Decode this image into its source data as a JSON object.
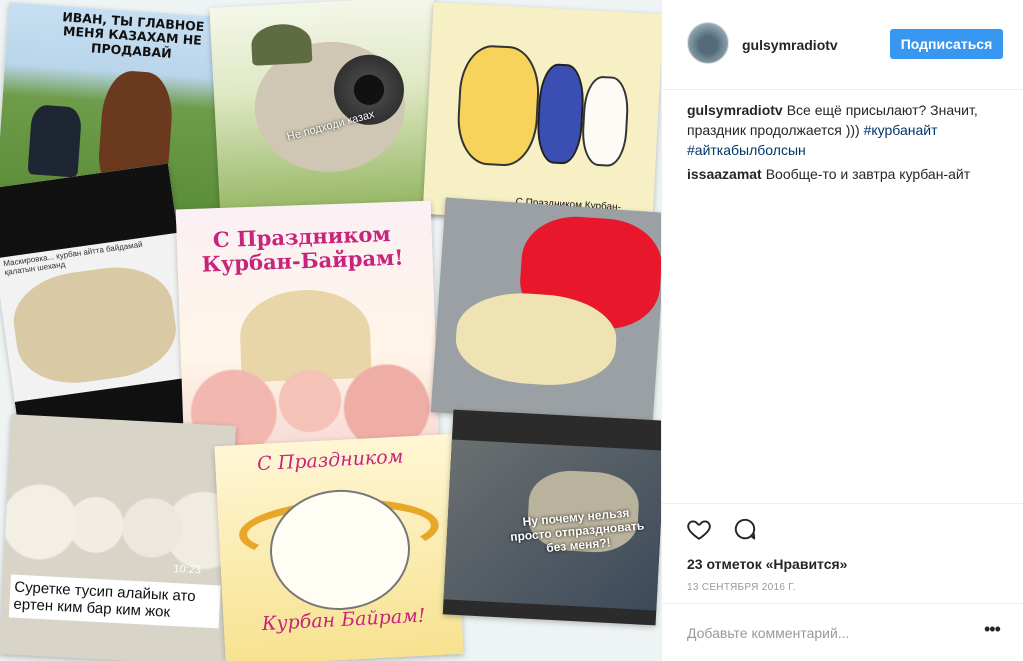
{
  "photo": {
    "card1_caption": "ИВАН, ТЫ ГЛАВНОЕ МЕНЯ КАЗАХАМ НЕ ПРОДАВАЙ",
    "card2_caption": "Не подходи казах",
    "card3_caption": "С Праздником Курбан-Байрам :)",
    "card4_caption": "Маскировка... курбан айтта байдамай қалатын шеханд",
    "card5_caption": "С Праздником Курбан-Байрам!",
    "card7_caption": "Суретке тусип алайык ато ертен ким бар ким жок",
    "card7_time": "10:23",
    "card8_caption_top": "С Праздником",
    "card8_caption_bottom": "Курбан Байрам!",
    "card9_caption": "Ну почему нельзя просто отпраздновать без меня?!"
  },
  "post": {
    "username": "gulsymradiotv",
    "follow_label": "Подписаться"
  },
  "comments": [
    {
      "user": "gulsymradiotv",
      "text": "Все ещё присылают? Значит, праздник продолжается ))) ",
      "tags": [
        "#курбанайт",
        "#айткабылболсын"
      ]
    },
    {
      "user": "issaazamat",
      "text": "Вообще-то и завтра курбан-айт",
      "tags": []
    }
  ],
  "footer": {
    "likes": "23 отметок «Нравится»",
    "date": "13 СЕНТЯБРЯ 2016 Г.",
    "comment_placeholder": "Добавьте комментарий...",
    "more_label": "•••"
  },
  "colors": {
    "accent": "#3897f0",
    "hashtag": "#003569",
    "text": "#262626",
    "muted": "#999999"
  }
}
